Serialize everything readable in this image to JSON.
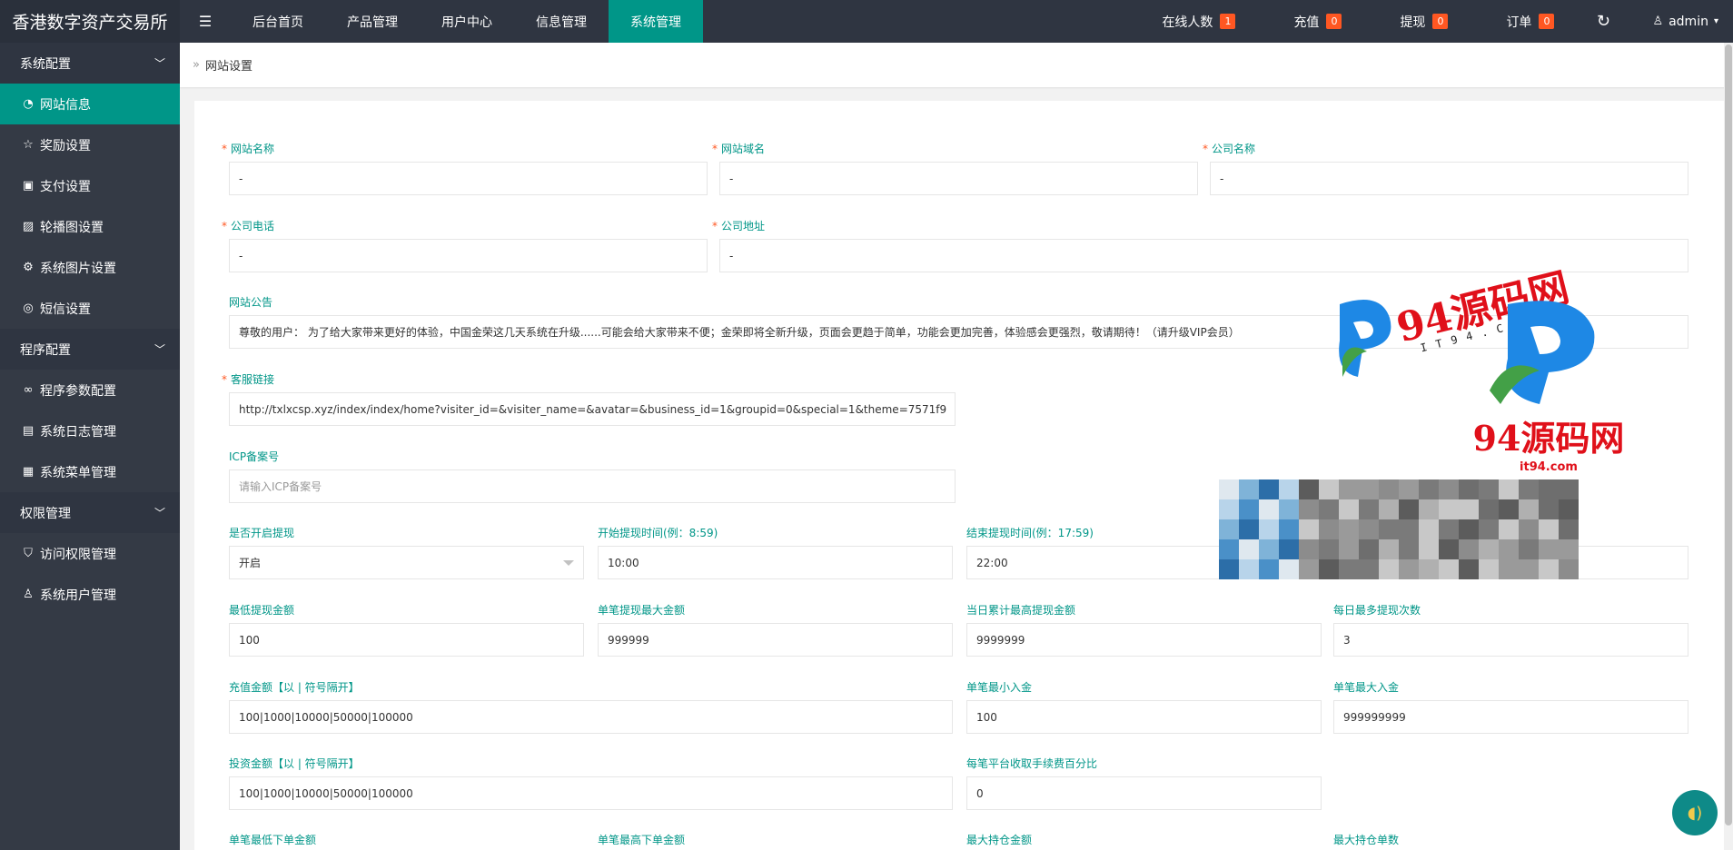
{
  "brand": "香港数字资产交易所",
  "topnav": [
    "后台首页",
    "产品管理",
    "用户中心",
    "信息管理",
    "系统管理"
  ],
  "top_right": {
    "online": {
      "label": "在线人数",
      "count": "1"
    },
    "recharge": {
      "label": "充值",
      "count": "0"
    },
    "withdraw": {
      "label": "提现",
      "count": "0"
    },
    "orders": {
      "label": "订单",
      "count": "0"
    },
    "user": "admin"
  },
  "sidebar": {
    "groups": [
      {
        "title": "系统配置",
        "items": [
          {
            "label": "网站信息",
            "icon": "dashboard-icon",
            "glyph": "◔"
          },
          {
            "label": "奖励设置",
            "icon": "star-icon",
            "glyph": "☆"
          },
          {
            "label": "支付设置",
            "icon": "money-icon",
            "glyph": "▣"
          },
          {
            "label": "轮播图设置",
            "icon": "picture-icon",
            "glyph": "▨"
          },
          {
            "label": "系统图片设置",
            "icon": "gear-icon",
            "glyph": "⚙"
          },
          {
            "label": "短信设置",
            "icon": "message-icon",
            "glyph": "◎"
          }
        ]
      },
      {
        "title": "程序配置",
        "items": [
          {
            "label": "程序参数配置",
            "icon": "link-icon",
            "glyph": "∞"
          },
          {
            "label": "系统日志管理",
            "icon": "log-icon",
            "glyph": "▤"
          },
          {
            "label": "系统菜单管理",
            "icon": "menu-icon",
            "glyph": "▦"
          }
        ]
      },
      {
        "title": "权限管理",
        "items": [
          {
            "label": "访问权限管理",
            "icon": "shield-icon",
            "glyph": "⛉"
          },
          {
            "label": "系统用户管理",
            "icon": "user-icon",
            "glyph": "♙"
          }
        ]
      }
    ]
  },
  "breadcrumb": "网站设置",
  "form": {
    "site_name": {
      "label": "网站名称",
      "value": "-"
    },
    "site_domain": {
      "label": "网站域名",
      "value": "-"
    },
    "company_name": {
      "label": "公司名称",
      "value": "-"
    },
    "company_phone": {
      "label": "公司电话",
      "value": "-"
    },
    "company_address": {
      "label": "公司地址",
      "value": "-"
    },
    "notice": {
      "label": "网站公告",
      "value": "尊敬的用户：  为了给大家带来更好的体验，中国金荣这几天系统在升级......可能会给大家带来不便；金荣即将全新升级，页面会更趋于简单，功能会更加完善，体验感会更强烈，敬请期待！（请升级VIP会员）"
    },
    "service_link": {
      "label": "客服链接",
      "value": "http://txlxcsp.xyz/index/index/home?visiter_id=&visiter_name=&avatar=&business_id=1&groupid=0&special=1&theme=7571f9"
    },
    "icp": {
      "label": "ICP备案号",
      "placeholder": "请输入ICP备案号"
    },
    "withdraw_enabled": {
      "label": "是否开启提现",
      "value": "开启"
    },
    "withdraw_start": {
      "label": "开始提现时间(例：8:59)",
      "value": "10:00"
    },
    "withdraw_end": {
      "label": "结束提现时间(例：17:59)",
      "value": "22:00"
    },
    "min_withdraw": {
      "label": "最低提现金额",
      "value": "100"
    },
    "max_single_withdraw": {
      "label": "单笔提现最大金额",
      "value": "999999"
    },
    "daily_max_withdraw": {
      "label": "当日累计最高提现金额",
      "value": "9999999"
    },
    "daily_withdraw_times": {
      "label": "每日最多提现次数",
      "value": "3"
    },
    "recharge_amounts": {
      "label": "充值金额【以 | 符号隔开】",
      "value": "100|1000|10000|50000|100000"
    },
    "min_deposit": {
      "label": "单笔最小入金",
      "value": "100"
    },
    "max_deposit": {
      "label": "单笔最大入金",
      "value": "999999999"
    },
    "invest_amounts": {
      "label": "投资金额【以 | 符号隔开】",
      "value": "100|1000|10000|50000|100000"
    },
    "fee_percent": {
      "label": "每笔平台收取手续费百分比",
      "value": "0"
    },
    "min_order": {
      "label": "单笔最低下单金额"
    },
    "max_order": {
      "label": "单笔最高下单金额"
    },
    "max_position_amount": {
      "label": "最大持仓金额"
    },
    "max_position_count": {
      "label": "最大持仓单数"
    }
  },
  "watermark": {
    "cn": "94源码网",
    "en": "IT94.COM",
    "small": "it94.com"
  },
  "colors": {
    "accent": "#009688",
    "topbar": "#2f3541",
    "sidebar": "#343a45",
    "badge": "#ff5722",
    "watermark": "#e0101a"
  }
}
